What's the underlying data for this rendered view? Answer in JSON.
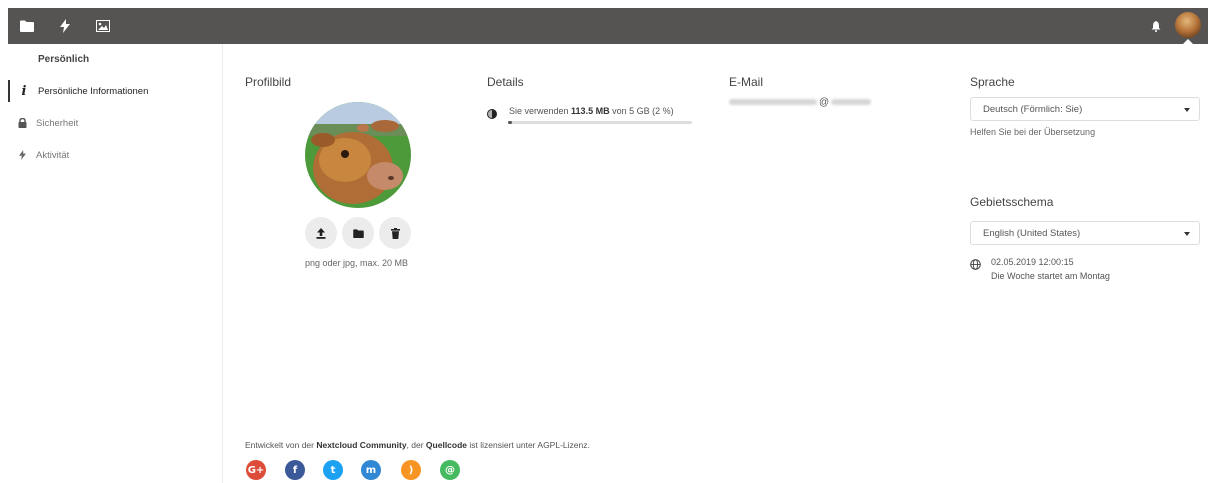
{
  "topbar": {
    "icons": [
      "files-icon",
      "activity-icon",
      "gallery-icon",
      "notifications-icon"
    ]
  },
  "sidebar": {
    "heading": "Persönlich",
    "items": [
      {
        "label": "Persönliche Informationen",
        "icon": "info-icon",
        "active": true
      },
      {
        "label": "Sicherheit",
        "icon": "lock-icon"
      },
      {
        "label": "Aktivität",
        "icon": "activity-icon"
      }
    ]
  },
  "profile": {
    "title": "Profilbild",
    "hint": "png oder jpg, max. 20 MB",
    "buttons": [
      "upload-icon",
      "folder-icon",
      "delete-icon"
    ]
  },
  "details": {
    "title": "Details",
    "usage_prefix": "Sie verwenden ",
    "usage_amount": "113.5 MB",
    "usage_suffix": " von 5 GB (2 %)",
    "quota_percent": 2
  },
  "email": {
    "title": "E-Mail",
    "at": "@"
  },
  "language": {
    "title": "Sprache",
    "selected": "Deutsch (Förmlich: Sie)",
    "help_link": "Helfen Sie bei der Übersetzung"
  },
  "locale": {
    "title": "Gebietsschema",
    "selected": "English (United States)",
    "datetime": "02.05.2019 12:00:15",
    "week_start": "Die Woche startet am Montag"
  },
  "footer": {
    "p1": "Entwickelt von der ",
    "link1": "Nextcloud Community",
    "p2": ", der ",
    "link2": "Quellcode",
    "p3": " ist lizensiert unter AGPL-Lizenz.",
    "social": [
      {
        "name": "google-plus",
        "label": "G+",
        "color": "#dd4b39"
      },
      {
        "name": "facebook",
        "label": "f",
        "color": "#3b5998"
      },
      {
        "name": "twitter",
        "label": "t",
        "color": "#1da1f2"
      },
      {
        "name": "mastodon",
        "label": "m",
        "color": "#3088d4"
      },
      {
        "name": "rss",
        "label": ")",
        "color": "#f79422"
      },
      {
        "name": "newsletter",
        "label": "@",
        "color": "#46ba61"
      }
    ]
  },
  "colors": {
    "header": "#555453",
    "accent": "#333333"
  }
}
